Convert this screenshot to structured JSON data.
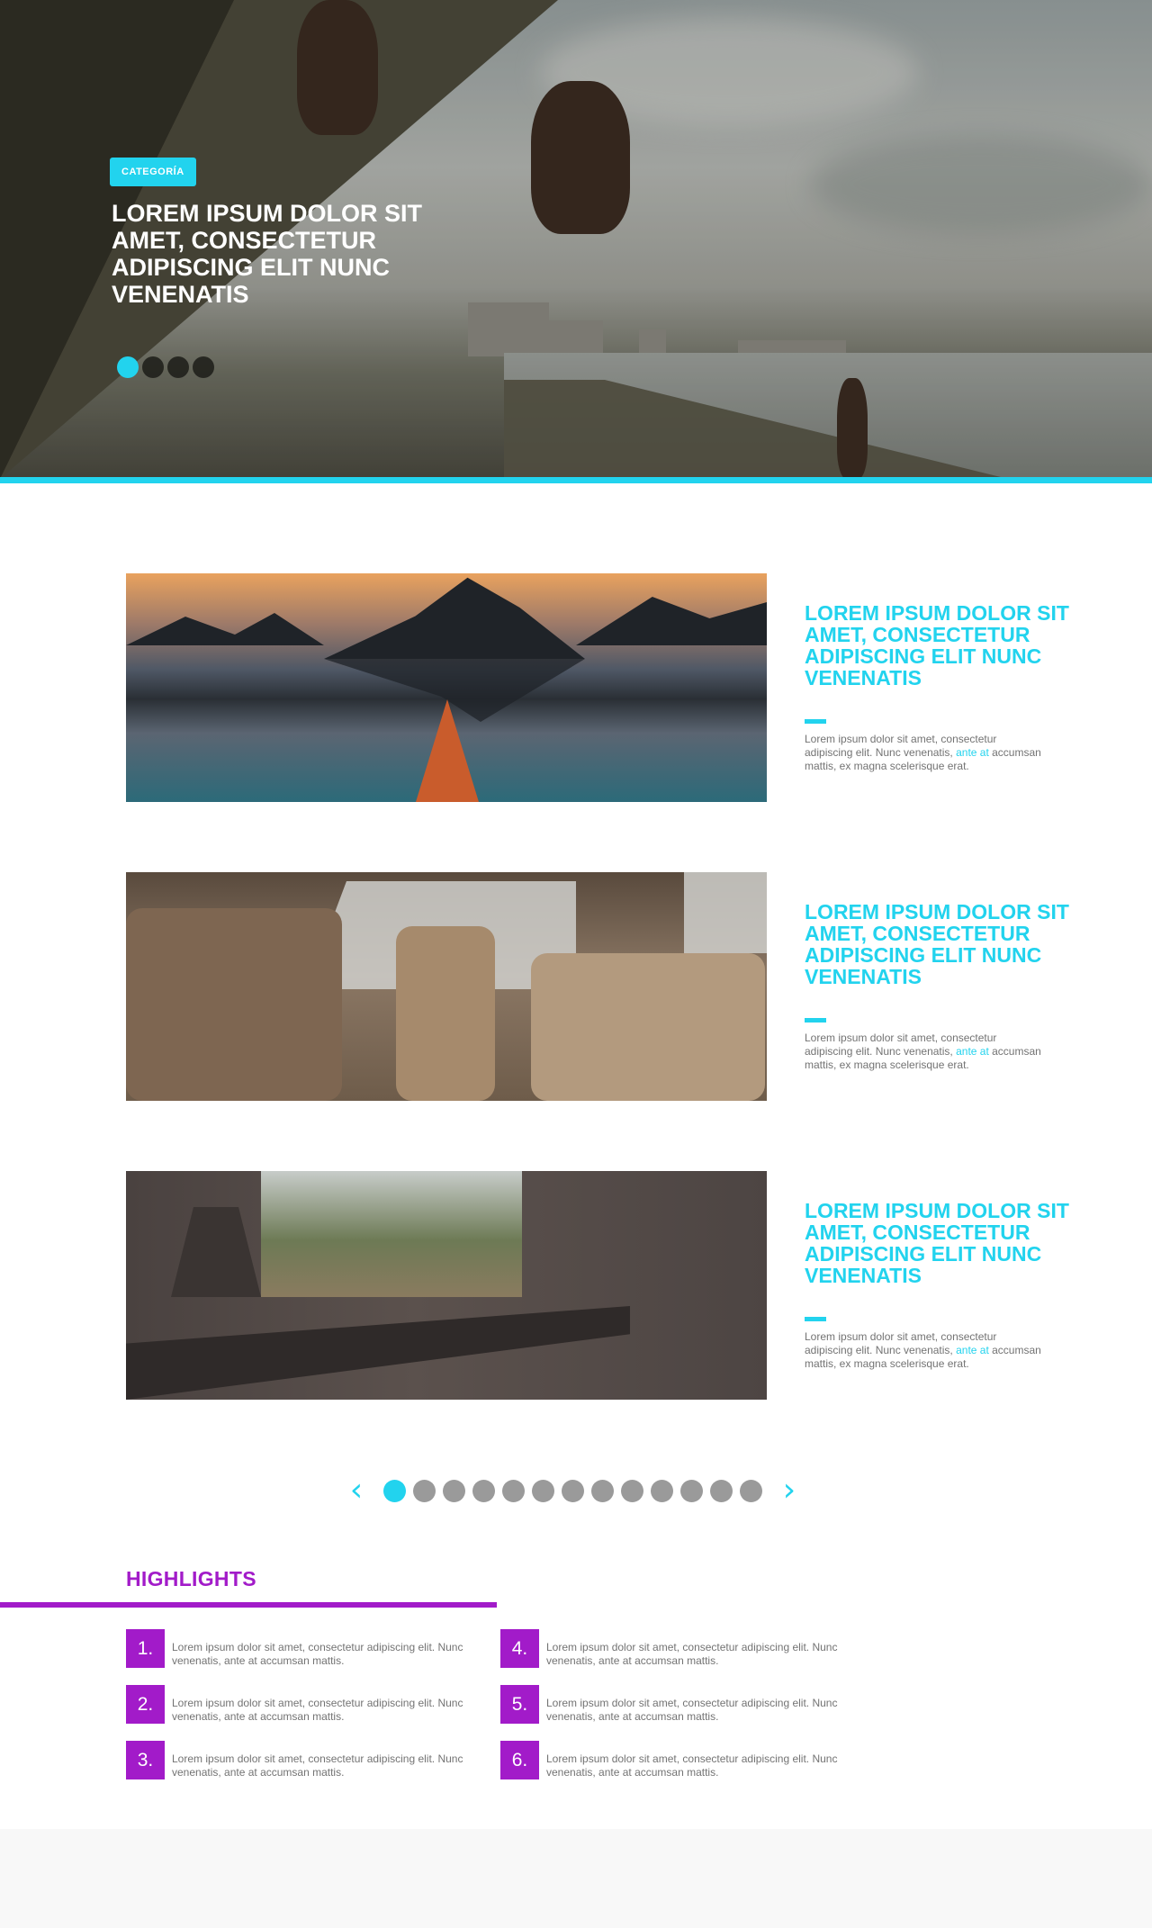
{
  "hero": {
    "category": "CATEGORÍA",
    "title": "LOREM IPSUM DOLOR SIT AMET, CONSECTETUR ADIPISCING ELIT NUNC VENENATIS",
    "slide_count": 4,
    "active_slide": 1
  },
  "articles": [
    {
      "title": "LOREM IPSUM DOLOR SIT AMET, CONSECTETUR ADIPISCING ELIT NUNC VENENATIS",
      "body_pre": "Lorem ipsum dolor sit amet, consectetur adipiscing elit. Nunc venenatis, ",
      "body_link": "ante at",
      "body_post": " accumsan mattis, ex magna scelerisque erat."
    },
    {
      "title": "LOREM IPSUM DOLOR SIT AMET, CONSECTETUR ADIPISCING ELIT NUNC VENENATIS",
      "body_pre": "Lorem ipsum dolor sit amet, consectetur adipiscing elit. Nunc venenatis, ",
      "body_link": "ante at",
      "body_post": " accumsan mattis, ex magna scelerisque erat."
    },
    {
      "title": "LOREM IPSUM DOLOR SIT AMET, CONSECTETUR ADIPISCING ELIT NUNC VENENATIS",
      "body_pre": "Lorem ipsum dolor sit amet, consectetur adipiscing elit. Nunc venenatis, ",
      "body_link": "ante at",
      "body_post": " accumsan mattis, ex magna scelerisque erat."
    }
  ],
  "pagination": {
    "prev_icon": "chevron-left-icon",
    "next_icon": "chevron-right-icon",
    "prev_glyph": "‹",
    "next_glyph": "›",
    "page_count": 13,
    "active_page": 1
  },
  "highlights": {
    "title": "HIGHLIGHTS",
    "items": [
      {
        "number": "1.",
        "text": "Lorem ipsum dolor sit amet, consectetur adipiscing elit. Nunc venenatis, ante at accumsan mattis."
      },
      {
        "number": "2.",
        "text": "Lorem ipsum dolor sit amet, consectetur adipiscing elit. Nunc venenatis, ante at accumsan mattis."
      },
      {
        "number": "3.",
        "text": "Lorem ipsum dolor sit amet, consectetur adipiscing elit. Nunc venenatis, ante at accumsan mattis."
      },
      {
        "number": "4.",
        "text": "Lorem ipsum dolor sit amet, consectetur adipiscing elit. Nunc venenatis, ante at accumsan mattis."
      },
      {
        "number": "5.",
        "text": "Lorem ipsum dolor sit amet, consectetur adipiscing elit. Nunc venenatis, ante at accumsan mattis."
      },
      {
        "number": "6.",
        "text": "Lorem ipsum dolor sit amet, consectetur adipiscing elit. Nunc venenatis, ante at accumsan mattis."
      }
    ]
  },
  "colors": {
    "accent": "#22d3ee",
    "highlight": "#a21bc9",
    "body_text": "#737373",
    "inactive_dot": "#9a9a9a"
  }
}
